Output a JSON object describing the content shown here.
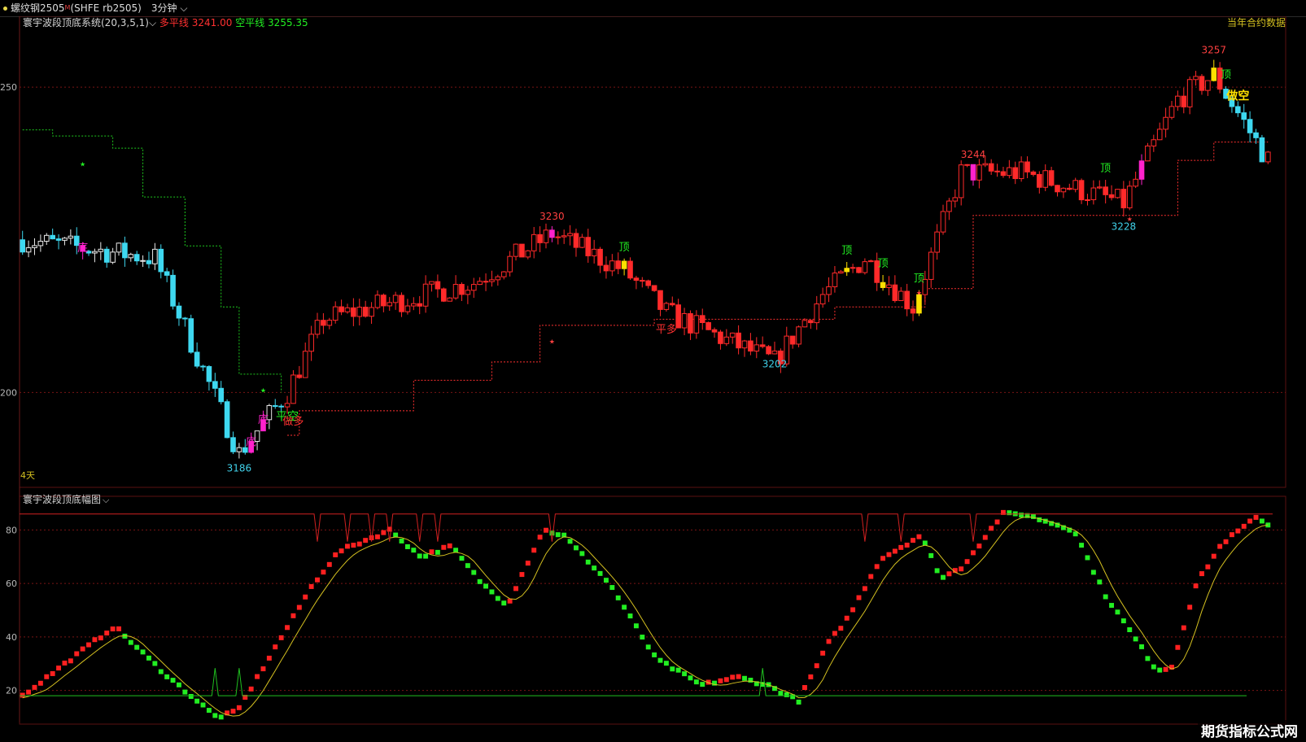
{
  "window": {
    "symbol": "螺纹钢2505",
    "symbol_sup": "M",
    "contract": "(SHFE rb2505)",
    "timeframe": "3分钟"
  },
  "main_panel": {
    "indicator_name": "寰宇波段顶底系统(20,3,5,1)",
    "long_line_label": "多平线",
    "long_line_value": "3241.00",
    "short_line_label": "空平线",
    "short_line_value": "3255.35",
    "right_note": "当年合约数据",
    "days_label": "4天",
    "y_ticks": [
      {
        "value": 3250,
        "label": "3250"
      },
      {
        "value": 3200,
        "label": "3200"
      }
    ],
    "colors": {
      "up": "#ff2a2a",
      "down": "#3ed8f0",
      "top": "#ffe000",
      "bottom": "#ff22cc",
      "long_line": "#ff3030",
      "short_line": "#1ec81e"
    }
  },
  "sub_panel": {
    "indicator_name": "寰宇波段顶底幅图",
    "y_ticks": [
      {
        "value": 20,
        "label": "20"
      },
      {
        "value": 40,
        "label": "40"
      },
      {
        "value": 60,
        "label": "60"
      },
      {
        "value": 80,
        "label": "80"
      }
    ],
    "upper_band": 86,
    "lower_band": 18,
    "colors": {
      "up": "#ff2020",
      "down": "#22ee22",
      "signal": "#d4c020"
    }
  },
  "chart_data": [
    {
      "type": "candlestick",
      "title": "寰宇波段顶底系统(20,3,5,1)",
      "ylim": [
        3185,
        3260
      ],
      "annotations": [
        {
          "bar": 36,
          "text": "3186",
          "kind": "low"
        },
        {
          "bar": 88,
          "text": "3230",
          "kind": "high"
        },
        {
          "bar": 125,
          "text": "3202",
          "kind": "low"
        },
        {
          "bar": 158,
          "text": "3244",
          "kind": "high"
        },
        {
          "bar": 183,
          "text": "3228",
          "kind": "low"
        },
        {
          "bar": 198,
          "text": "3257",
          "kind": "high"
        }
      ],
      "signals": [
        {
          "bar": 10,
          "text": "底",
          "kind": "bottom"
        },
        {
          "bar": 38,
          "text": "底",
          "kind": "bottom"
        },
        {
          "bar": 40,
          "text": "底",
          "kind": "bottom"
        },
        {
          "bar": 44,
          "text": "平空",
          "kind": "cover"
        },
        {
          "bar": 45,
          "text": "做多",
          "kind": "long"
        },
        {
          "bar": 100,
          "text": "顶",
          "kind": "top"
        },
        {
          "bar": 107,
          "text": "平多",
          "kind": "exit"
        },
        {
          "bar": 137,
          "text": "顶",
          "kind": "top"
        },
        {
          "bar": 143,
          "text": "顶",
          "kind": "top"
        },
        {
          "bar": 149,
          "text": "顶",
          "kind": "top"
        },
        {
          "bar": 180,
          "text": "顶",
          "kind": "top"
        },
        {
          "bar": 200,
          "text": "顶",
          "kind": "top"
        },
        {
          "bar": 202,
          "text": "做空",
          "kind": "short"
        }
      ]
    },
    {
      "type": "bar",
      "title": "寰宇波段顶底幅图",
      "ylim": [
        8,
        92
      ]
    }
  ]
}
